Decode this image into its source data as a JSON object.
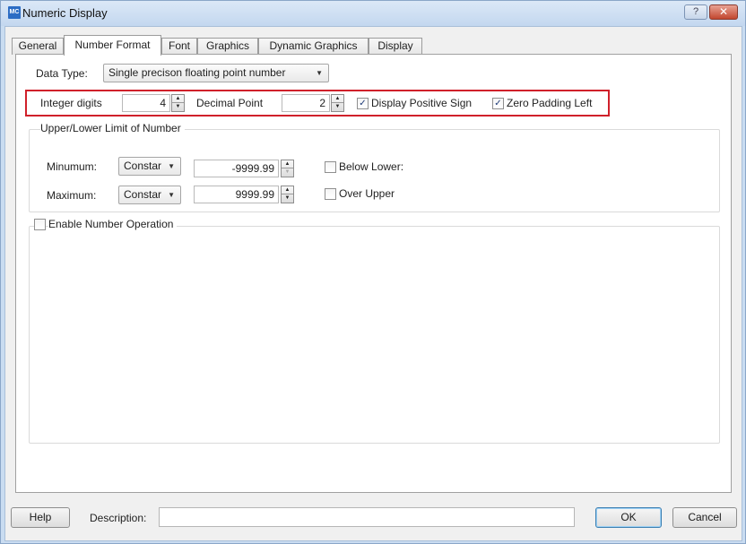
{
  "window": {
    "title": "Numeric Display",
    "icon_text": "MC",
    "help_glyph": "?",
    "close_glyph": "✕"
  },
  "tabs": [
    {
      "label": "General"
    },
    {
      "label": "Number Format"
    },
    {
      "label": "Font"
    },
    {
      "label": "Graphics"
    },
    {
      "label": "Dynamic Graphics"
    },
    {
      "label": "Display"
    }
  ],
  "active_tab": "Number Format",
  "data_type": {
    "label": "Data Type:",
    "value": "Single precison floating point number"
  },
  "format_row": {
    "integer_digits_label": "Integer digits",
    "integer_digits_value": "4",
    "decimal_point_label": "Decimal Point",
    "decimal_point_value": "2",
    "display_positive_sign_label": "Display Positive Sign",
    "display_positive_sign_checked": true,
    "zero_padding_left_label": "Zero Padding Left",
    "zero_padding_left_checked": true
  },
  "limits": {
    "title": "Upper/Lower Limit of Number",
    "minimum_label": "Minumum:",
    "minimum_mode": "Constar",
    "minimum_value": "-9999.99",
    "maximum_label": "Maximum:",
    "maximum_mode": "Constar",
    "maximum_value": "9999.99",
    "below_lower_label": "Below Lower:",
    "below_lower_checked": false,
    "over_upper_label": "Over Upper",
    "over_upper_checked": false
  },
  "operation": {
    "label": "Enable Number Operation",
    "checked": false
  },
  "footer": {
    "help_label": "Help",
    "description_label": "Description:",
    "description_value": "",
    "ok_label": "OK",
    "cancel_label": "Cancel"
  },
  "colors": {
    "highlight_border": "#d0202a",
    "titlebar": "#c9dcf1"
  },
  "check_glyph": "✓",
  "dropdown_glyph": "▼"
}
